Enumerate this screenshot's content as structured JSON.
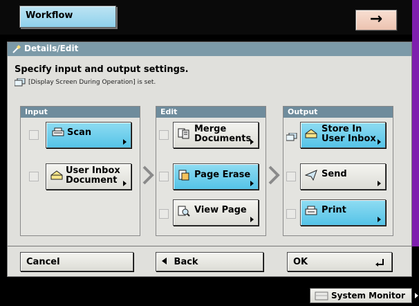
{
  "topbar": {
    "workflow_tab": "Workflow",
    "arrow_label": "→"
  },
  "panel": {
    "title": "Details/Edit",
    "instruction": "Specify input and output settings.",
    "display_note": "[Display Screen During Operation] is set."
  },
  "sections": {
    "input": {
      "header": "Input",
      "scan": "Scan",
      "user_inbox_doc_1": "User Inbox",
      "user_inbox_doc_2": "Document"
    },
    "edit": {
      "header": "Edit",
      "merge_1": "Merge",
      "merge_2": "Documents",
      "page_erase": "Page Erase",
      "view_page": "View Page"
    },
    "output": {
      "header": "Output",
      "store_1": "Store In",
      "store_2": "User Inbox",
      "send": "Send",
      "print": "Print"
    }
  },
  "footer": {
    "cancel": "Cancel",
    "back": "Back",
    "ok": "OK"
  },
  "status": {
    "system_monitor": "System Monitor"
  },
  "colors": {
    "selected": "#55c3e7",
    "header_bar": "#7c9aa8",
    "accent_strip": "#7e1fae"
  },
  "icons": [
    "wand-icon",
    "display-screen-icon",
    "scanner-icon",
    "inbox-icon",
    "merge-icon",
    "page-erase-icon",
    "view-page-icon",
    "send-icon",
    "print-icon",
    "chevron-right-icon",
    "monitor-icon"
  ]
}
